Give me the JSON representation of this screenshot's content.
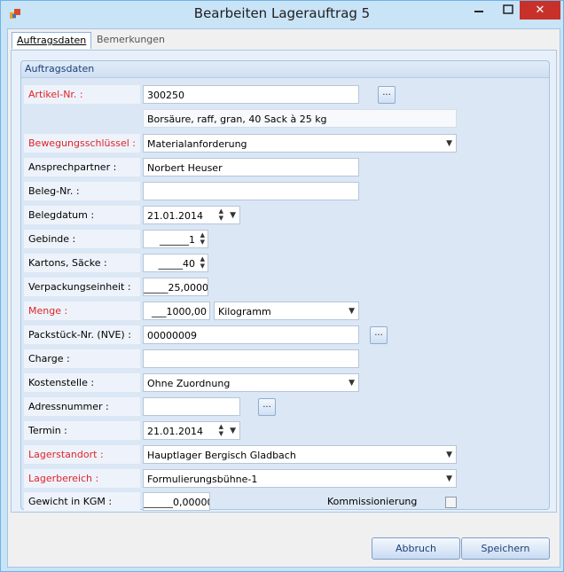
{
  "window": {
    "title": "Bearbeiten Lagerauftrag 5",
    "close_label": "✕",
    "minimize_label": "—",
    "maximize_label": "☐"
  },
  "tabs": [
    {
      "label": "Auftragsdaten"
    },
    {
      "label": "Bemerkungen"
    }
  ],
  "group": {
    "title": "Auftragsdaten"
  },
  "form": {
    "artikel_nr": {
      "label": "Artikel-Nr. :",
      "value": "300250",
      "button": "..."
    },
    "artikel_desc": {
      "value": "Borsäure, raff, gran, 40 Sack à 25 kg"
    },
    "bewegungsschluessel": {
      "label": "Bewegungsschlüssel :",
      "value": "Materialanforderung"
    },
    "ansprechpartner": {
      "label": "Ansprechpartner :",
      "value": "Norbert Heuser"
    },
    "beleg_nr": {
      "label": "Beleg-Nr. :",
      "value": ""
    },
    "belegdatum": {
      "label": "Belegdatum :",
      "value": "21.01.2014"
    },
    "gebinde": {
      "label": "Gebinde :",
      "value": "______1"
    },
    "kartons": {
      "label": "Kartons, Säcke :",
      "value": "_____40"
    },
    "verpackungseinheit": {
      "label": "Verpackungseinheit :",
      "value": "_____25,0000"
    },
    "menge": {
      "label": "Menge :",
      "value": "___1000,00",
      "unit": "Kilogramm"
    },
    "packstueck": {
      "label": "Packstück-Nr. (NVE) :",
      "value": "00000009",
      "button": "..."
    },
    "charge": {
      "label": "Charge :",
      "value": ""
    },
    "kostenstelle": {
      "label": "Kostenstelle :",
      "value": "Ohne Zuordnung"
    },
    "adressnummer": {
      "label": "Adressnummer :",
      "value": "",
      "button": "..."
    },
    "termin": {
      "label": "Termin :",
      "value": "21.01.2014"
    },
    "lagerstandort": {
      "label": "Lagerstandort :",
      "value": "Hauptlager Bergisch Gladbach"
    },
    "lagerbereich": {
      "label": "Lagerbereich :",
      "value": "Formulierungsbühne-1"
    },
    "gewicht": {
      "label": "Gewicht in KGM :",
      "value": "______0,00000"
    },
    "kommissionierung": {
      "label": "Kommissionierung",
      "checked": false
    }
  },
  "footer": {
    "cancel_label": "Abbruch",
    "save_label": "Speichern"
  },
  "colors": {
    "required_label": "#e0242a",
    "close_button": "#c7312a",
    "window_frame": "#c9e3f7"
  },
  "icons": {
    "app": "app-icon",
    "dropdown": "chevron-down-icon",
    "spin": "spin-arrows-icon"
  }
}
